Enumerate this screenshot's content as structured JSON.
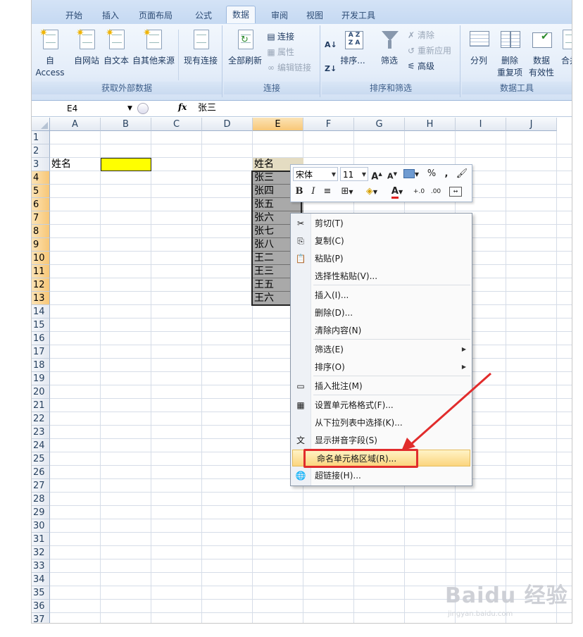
{
  "ribbon": {
    "tabs": [
      "开始",
      "插入",
      "页面布局",
      "公式",
      "数据",
      "审阅",
      "视图",
      "开发工具"
    ],
    "groups": {
      "external": {
        "label": "获取外部数据",
        "buttons": [
          "自 Access",
          "自网站",
          "自文本",
          "自其他来源",
          "现有连接"
        ]
      },
      "connections": {
        "label": "连接",
        "refresh": "全部刷新",
        "items": [
          "连接",
          "属性",
          "编辑链接"
        ]
      },
      "sort_filter": {
        "label": "排序和筛选",
        "sort": "排序...",
        "filter": "筛选",
        "items": [
          "清除",
          "重新应用",
          "高级"
        ]
      },
      "data_tools": {
        "label": "数据工具",
        "split": "分列",
        "remove_dup_1": "删除",
        "remove_dup_2": "重复项",
        "validation_1": "数据",
        "validation_2": "有效性",
        "merge": "合并"
      }
    }
  },
  "formula_bar": {
    "name_box": "E4",
    "fx": "fx",
    "content": "张三"
  },
  "sheet": {
    "columns": [
      "A",
      "B",
      "C",
      "D",
      "E",
      "F",
      "G",
      "H",
      "I",
      "J"
    ],
    "selected_column": "E",
    "rows": [
      "1",
      "2",
      "3",
      "4",
      "5",
      "6",
      "7",
      "8",
      "9",
      "10",
      "11",
      "12",
      "13",
      "14",
      "15",
      "16",
      "17",
      "18",
      "19",
      "20",
      "21",
      "22",
      "23",
      "24",
      "25",
      "26",
      "27",
      "28",
      "29",
      "30",
      "31",
      "32",
      "33",
      "34",
      "35",
      "36",
      "37"
    ],
    "a3": "姓名",
    "e3": "姓名",
    "e_values": [
      "张三",
      "张四",
      "张五",
      "张六",
      "张七",
      "张八",
      "王二",
      "王三",
      "王五",
      "王六"
    ]
  },
  "mini_toolbar": {
    "font": "宋体",
    "size": "11",
    "grow": "A",
    "shrink": "A",
    "percent": "%",
    "comma": ",",
    "bold": "B",
    "italic": "I",
    "font_color_label": "A",
    "inc_decimal": "+.0",
    "dec_decimal": ".00"
  },
  "context_menu": {
    "items": [
      {
        "label": "剪切(T)",
        "icon": "scissors-icon"
      },
      {
        "label": "复制(C)",
        "icon": "copy-icon"
      },
      {
        "label": "粘贴(P)",
        "icon": "paste-icon"
      },
      {
        "label": "选择性粘贴(V)...",
        "icon": ""
      },
      {
        "label": "插入(I)...",
        "icon": ""
      },
      {
        "label": "删除(D)...",
        "icon": ""
      },
      {
        "label": "清除内容(N)",
        "icon": ""
      },
      {
        "label": "筛选(E)",
        "icon": ""
      },
      {
        "label": "排序(O)",
        "icon": ""
      },
      {
        "label": "插入批注(M)",
        "icon": "comment-icon"
      },
      {
        "label": "设置单元格格式(F)...",
        "icon": "format-cells-icon"
      },
      {
        "label": "从下拉列表中选择(K)...",
        "icon": ""
      },
      {
        "label": "显示拼音字段(S)",
        "icon": "phonetic-icon"
      },
      {
        "label": "命名单元格区域(R)...",
        "icon": ""
      },
      {
        "label": "超链接(H)...",
        "icon": "hyperlink-icon"
      }
    ],
    "highlighted": "命名单元格区域(R)..."
  },
  "watermark": {
    "brand": "Baidu 经验",
    "url": "jingyan.baidu.com"
  },
  "annotation_color": "#e12c2c",
  "accent_selection": "#f8c777"
}
